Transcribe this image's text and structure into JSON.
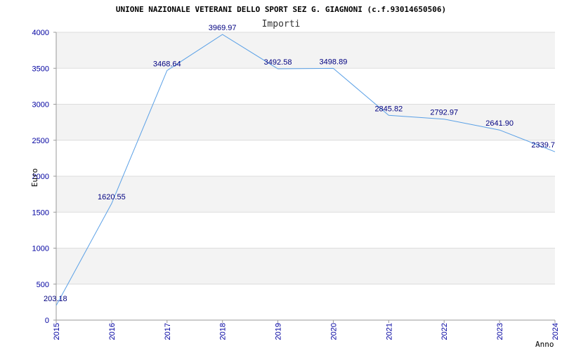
{
  "chart_data": {
    "type": "line",
    "title": "UNIONE NAZIONALE VETERANI DELLO SPORT SEZ G. GIAGNONI (c.f.93014650506)",
    "subtitle": "Importi",
    "xlabel": "Anno",
    "ylabel": "Euro",
    "x": [
      "2015",
      "2016",
      "2017",
      "2018",
      "2019",
      "2020",
      "2021",
      "2022",
      "2023",
      "2024"
    ],
    "series": [
      {
        "values": [
          203.18,
          1620.55,
          3468.64,
          3969.97,
          3492.58,
          3498.89,
          2845.82,
          2792.97,
          2641.9,
          2339.7
        ],
        "labels": [
          "203.18",
          "1620.55",
          "3468.64",
          "3969.97",
          "3492.58",
          "3498.89",
          "2845.82",
          "2792.97",
          "2641.90",
          "2339.7"
        ],
        "color": "#5aa0e6"
      }
    ],
    "yticks": [
      "0",
      "500",
      "1000",
      "1500",
      "2000",
      "2500",
      "3000",
      "3500",
      "4000"
    ],
    "ylim": [
      0,
      4000
    ],
    "grid": true,
    "band_color": "#f3f3f3",
    "grid_color": "#dddddd",
    "tick_color": "#0000a0"
  }
}
